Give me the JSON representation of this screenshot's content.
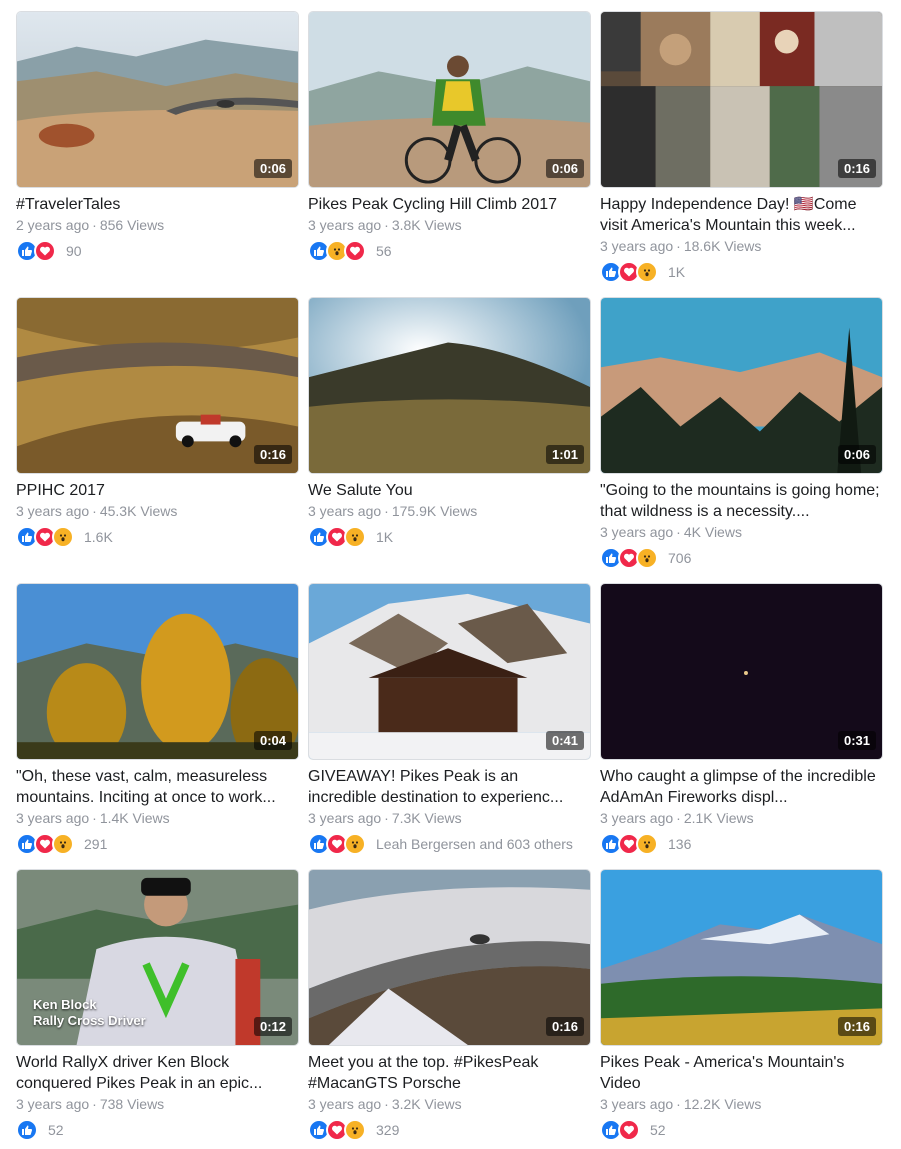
{
  "videos": [
    {
      "title": "#TravelerTales",
      "age": "2 years ago",
      "views": "856 Views",
      "duration": "0:06",
      "reactions": [
        "like",
        "love"
      ],
      "count": "90"
    },
    {
      "title": "Pikes Peak Cycling Hill Climb 2017",
      "age": "3 years ago",
      "views": "3.8K Views",
      "duration": "0:06",
      "reactions": [
        "like",
        "wow",
        "love"
      ],
      "count": "56"
    },
    {
      "title": "Happy Independence Day! 🇺🇸Come visit America's Mountain this week...",
      "age": "3 years ago",
      "views": "18.6K Views",
      "duration": "0:16",
      "reactions": [
        "like",
        "love",
        "wow"
      ],
      "count": "1K"
    },
    {
      "title": "PPIHC 2017",
      "age": "3 years ago",
      "views": "45.3K Views",
      "duration": "0:16",
      "reactions": [
        "like",
        "love",
        "wow"
      ],
      "count": "1.6K"
    },
    {
      "title": "We Salute You",
      "age": "3 years ago",
      "views": "175.9K Views",
      "duration": "1:01",
      "reactions": [
        "like",
        "love",
        "wow"
      ],
      "count": "1K"
    },
    {
      "title": "\"Going to the mountains is going home; that wildness is a necessity....",
      "age": "3 years ago",
      "views": "4K Views",
      "duration": "0:06",
      "reactions": [
        "like",
        "love",
        "wow"
      ],
      "count": "706"
    },
    {
      "title": "\"Oh, these vast, calm, measureless mountains. Inciting at once to work...",
      "age": "3 years ago",
      "views": "1.4K Views",
      "duration": "0:04",
      "reactions": [
        "like",
        "love",
        "wow"
      ],
      "count": "291"
    },
    {
      "title": "GIVEAWAY! Pikes Peak is an incredible destination to experienc...",
      "age": "3 years ago",
      "views": "7.3K Views",
      "duration": "0:41",
      "reactions": [
        "like",
        "love",
        "wow"
      ],
      "count": "Leah Bergersen and 603 others"
    },
    {
      "title": "Who caught a glimpse of the incredible AdAmAn Fireworks displ...",
      "age": "3 years ago",
      "views": "2.1K Views",
      "duration": "0:31",
      "reactions": [
        "like",
        "love",
        "wow"
      ],
      "count": "136"
    },
    {
      "title": "World RallyX driver Ken Block conquered Pikes Peak in an epic...",
      "age": "3 years ago",
      "views": "738 Views",
      "duration": "0:12",
      "reactions": [
        "like"
      ],
      "count": "52",
      "overlay": [
        "Ken Block",
        "Rally Cross Driver"
      ]
    },
    {
      "title": "Meet you at the top. #PikesPeak #MacanGTS Porsche",
      "age": "3 years ago",
      "views": "3.2K Views",
      "duration": "0:16",
      "reactions": [
        "like",
        "love",
        "wow"
      ],
      "count": "329"
    },
    {
      "title": "Pikes Peak - America's Mountain's Video",
      "age": "3 years ago",
      "views": "12.2K Views",
      "duration": "0:16",
      "reactions": [
        "like",
        "love"
      ],
      "count": "52"
    }
  ],
  "colors": {
    "like": "#1877f2",
    "love": "#f0284a",
    "wow": "#f7b125",
    "meta": "#90949c"
  }
}
